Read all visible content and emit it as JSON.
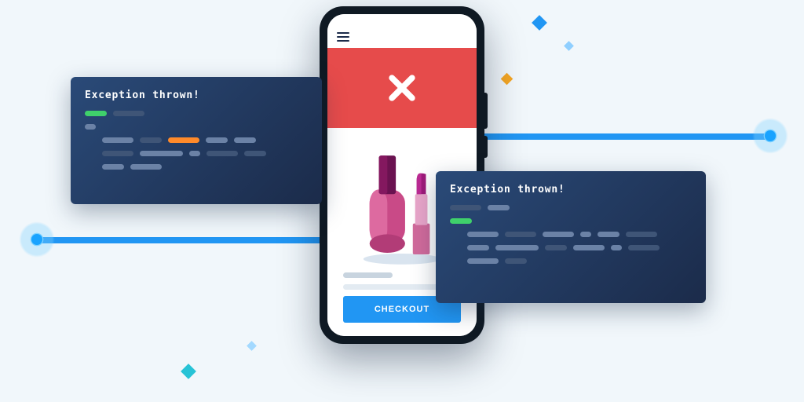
{
  "exception_left": {
    "title": "Exception thrown!"
  },
  "exception_right": {
    "title": "Exception thrown!"
  },
  "phone": {
    "checkout_label": "CHECKOUT"
  },
  "colors": {
    "panel_bg": "#1b2b4a",
    "accent_blue": "#2196f3",
    "error_red": "#e64b4b",
    "code_green": "#3fd16b",
    "code_orange": "#ff8a2a",
    "bg": "#f1f7fb"
  },
  "icons": {
    "error": "x-icon",
    "menu": "hamburger-icon"
  }
}
